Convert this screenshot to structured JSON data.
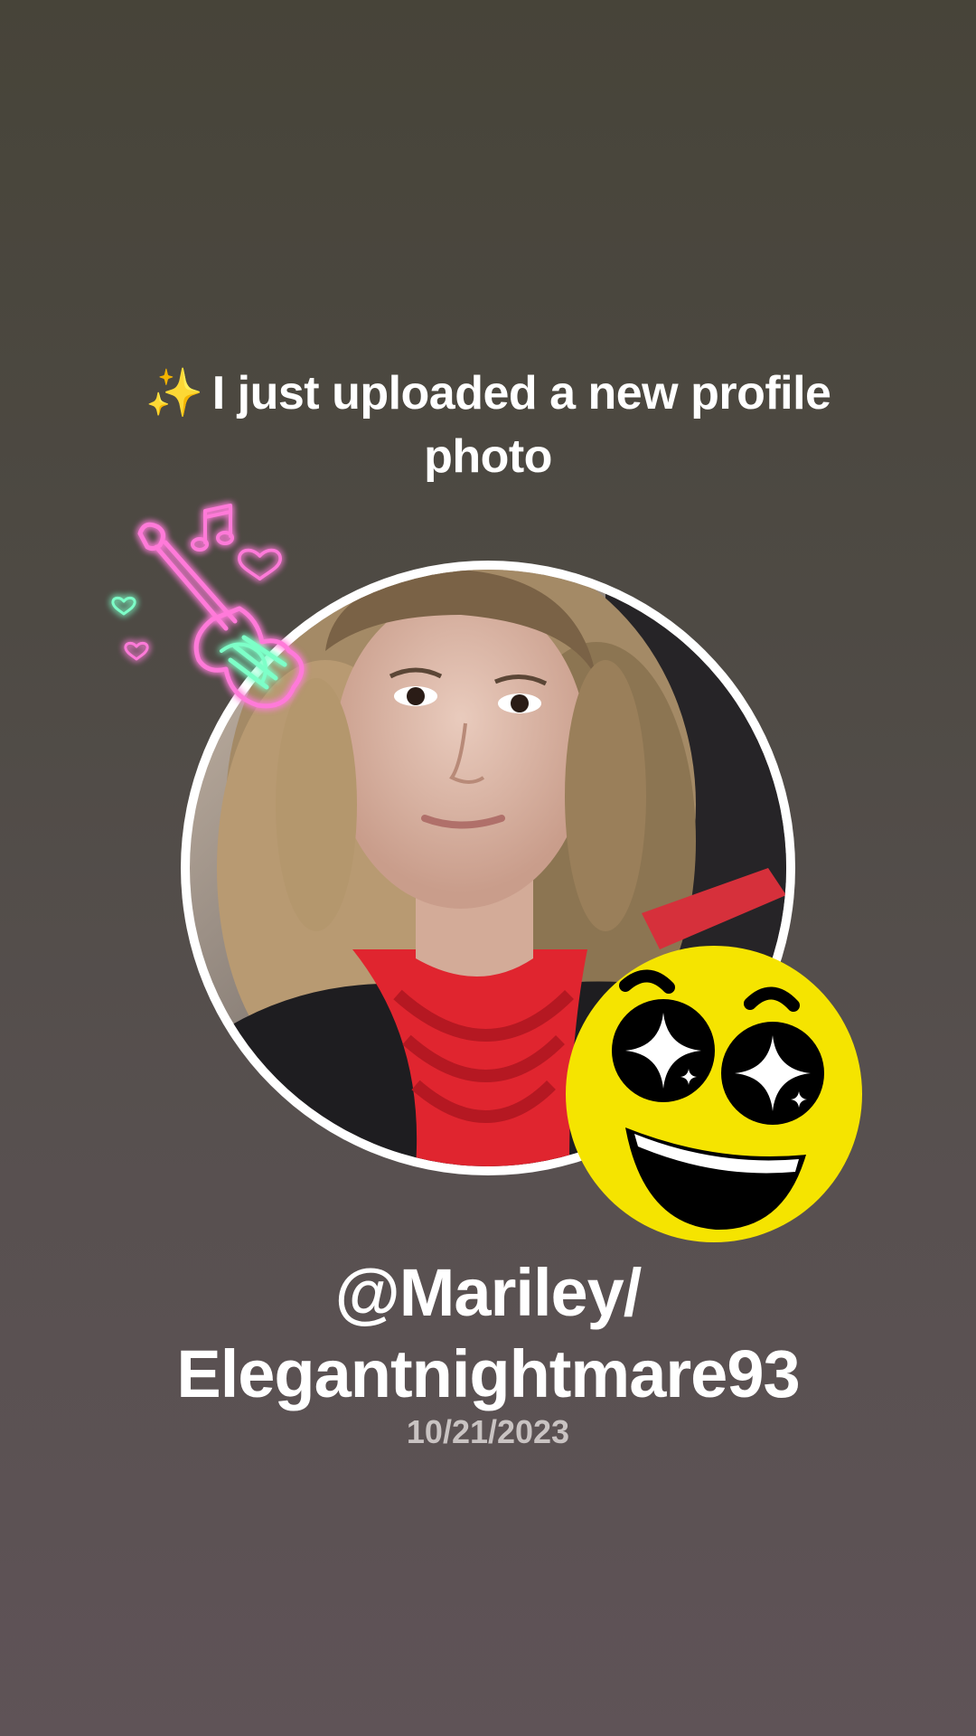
{
  "post": {
    "headline_icon": "sparkles-icon",
    "headline_sparkle": "✨",
    "headline_text": "I just uploaded a new profile photo",
    "username_line1": "@Mariley/",
    "username_line2": "Elegantnightmare93",
    "date": "10/21/2023"
  },
  "stickers": {
    "neon": "neon-guitar-hearts-music-notes",
    "emoji": "star-eyes-grinning-face"
  },
  "colors": {
    "background_top": "#474439",
    "background_bottom": "#5f5357",
    "text": "#ffffff",
    "date_text": "#c9c3c2",
    "ring": "#ffffff",
    "emoji_yellow": "#f5e400",
    "neon_pink": "#ff7ad9",
    "neon_green": "#7dffc8"
  }
}
